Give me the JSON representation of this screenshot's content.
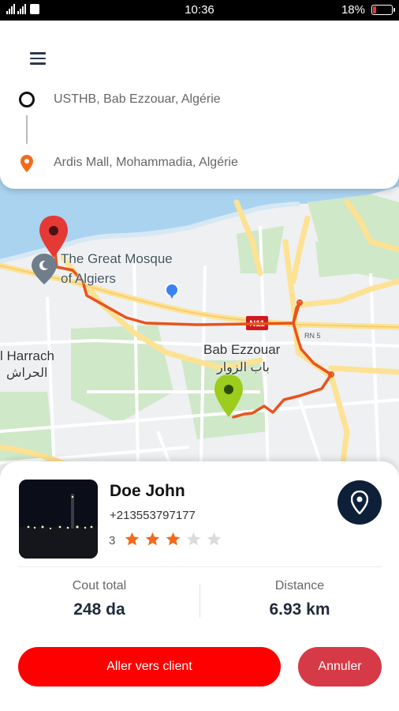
{
  "status_bar": {
    "time": "10:36",
    "battery_percent": "18%",
    "battery_level": 0.18,
    "battery_color": "#e53935"
  },
  "route": {
    "origin": "USTHB, Bab Ezzouar, Algérie",
    "destination": "Ardis Mall, Mohammadia, Algérie",
    "destination_color": "#f26a1b"
  },
  "map": {
    "labels": {
      "mosque_line1": "The Great Mosque",
      "mosque_line2": "of Algiers",
      "harrach": "l Harrach",
      "harrach_ar": "الحراش",
      "bab_ezzouar": "Bab Ezzouar",
      "bab_ezzouar_ar": "باب الزوار",
      "n11": "N11",
      "rn5": "RN 5"
    },
    "route_color": "#e8531c",
    "start_pin_color": "#9ccc1c",
    "end_pin_color": "#e53935"
  },
  "driver": {
    "name": "Doe John",
    "phone": "+213553797177",
    "rating": "3",
    "rating_value": 3,
    "rating_max": 5,
    "star_color": "#f26a1b",
    "star_empty_color": "#dcdcdc"
  },
  "stats": {
    "total_label": "Cout total",
    "total_value": "248 da",
    "distance_label": "Distance",
    "distance_value": "6.93 km"
  },
  "actions": {
    "primary": "Aller vers client",
    "secondary": "Annuler"
  },
  "icons": [
    "menu-icon",
    "origin-circle-icon",
    "location-pin-icon",
    "star-icon",
    "map-pin-icon"
  ]
}
